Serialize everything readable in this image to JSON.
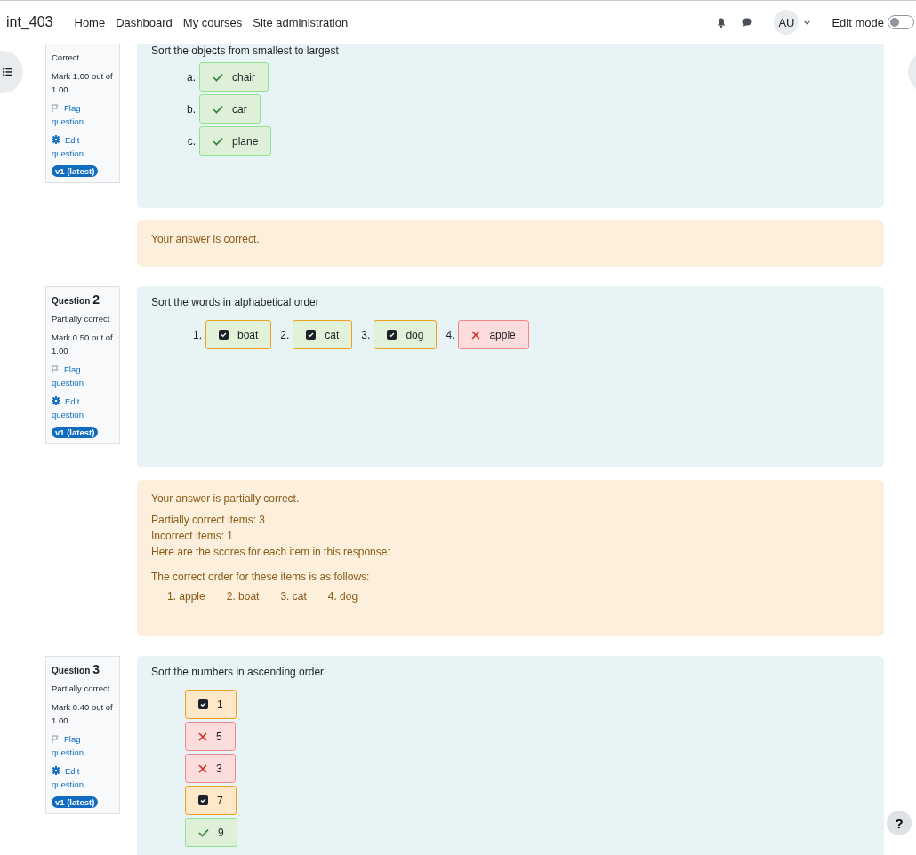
{
  "navbar": {
    "brand": "int_403",
    "links": [
      {
        "label": "Home"
      },
      {
        "label": "Dashboard"
      },
      {
        "label": "My courses"
      },
      {
        "label": "Site administration"
      }
    ],
    "avatar": "AU",
    "edit_mode": {
      "label": "Edit mode",
      "on": false
    }
  },
  "questions": [
    {
      "state": "Correct",
      "mark": "Mark 1.00 out of 1.00",
      "flag": "Flag question",
      "edit": "Edit question",
      "badge": "v1 (latest)",
      "text": "Sort the objects from smallest to largest",
      "kind": "vertical",
      "items": [
        {
          "prefix": "a.",
          "label": "chair",
          "kind": "correct"
        },
        {
          "prefix": "b.",
          "label": "car",
          "kind": "correct"
        },
        {
          "prefix": "c.",
          "label": "plane",
          "kind": "correct"
        }
      ],
      "feedback": {
        "general": "Your answer is correct."
      }
    },
    {
      "number_label": "Question",
      "number": "2",
      "state": "Partially correct",
      "mark": "Mark 0.50 out of 1.00",
      "flag": "Flag question",
      "edit": "Edit question",
      "badge": "v1 (latest)",
      "text": "Sort the words in alphabetical order",
      "kind": "horizontal",
      "items": [
        {
          "prefix": "1.",
          "label": "boat",
          "kind": "partial"
        },
        {
          "prefix": "2.",
          "label": "cat",
          "kind": "partial"
        },
        {
          "prefix": "3.",
          "label": "dog",
          "kind": "partial"
        },
        {
          "prefix": "4.",
          "label": "apple",
          "kind": "incorrect"
        }
      ],
      "feedback": {
        "general": "Your answer is partially correct.",
        "lines": [
          "Partially correct items: 3",
          "Incorrect items: 1",
          "Here are the scores for each item in this response:"
        ],
        "order_heading": "The correct order for these items is as follows:",
        "order": [
          "1. apple",
          "2. boat",
          "3. cat",
          "4. dog"
        ]
      }
    },
    {
      "number_label": "Question",
      "number": "3",
      "state": "Partially correct",
      "mark": "Mark 0.40 out of 1.00",
      "flag": "Flag question",
      "edit": "Edit question",
      "badge": "v1 (latest)",
      "text": "Sort the numbers in ascending order",
      "kind": "vertical",
      "items": [
        {
          "label": "1",
          "kind": "partial"
        },
        {
          "label": "5",
          "kind": "incorrect"
        },
        {
          "label": "3",
          "kind": "incorrect"
        },
        {
          "label": "7",
          "kind": "partial"
        },
        {
          "label": "9",
          "kind": "correct"
        }
      ]
    }
  ],
  "help": "?"
}
